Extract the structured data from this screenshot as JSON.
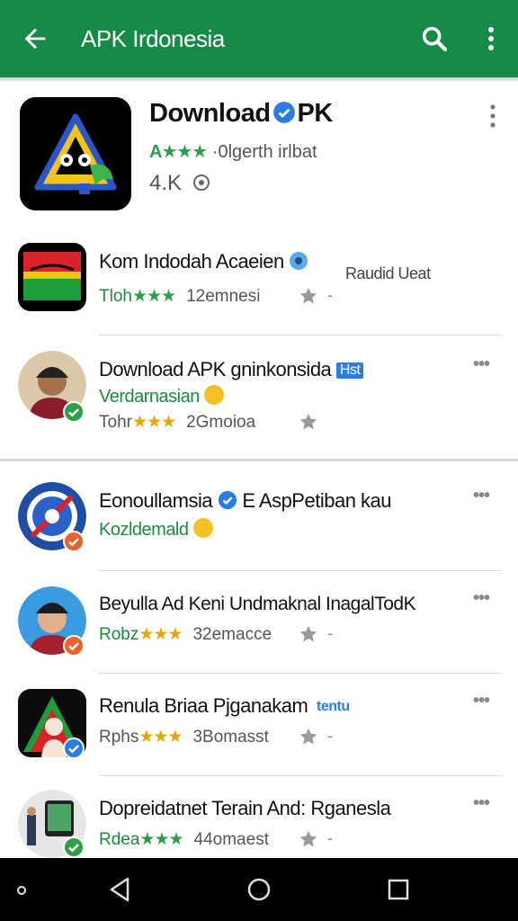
{
  "appbar": {
    "title": "APK Irdonesia",
    "back_icon": "arrow-left-icon",
    "search_icon": "search-icon",
    "menu_icon": "more-vert-icon"
  },
  "featured": {
    "title_pre": "Download",
    "title_post": "PK",
    "rating_stars": "A★★★",
    "rating_text": "·0lgerth irlbat",
    "count": "4.K",
    "count_icon": "info-icon"
  },
  "apps": [
    {
      "name": "Kom Indodah Acaeien",
      "side_text": "Raudid Ueat",
      "meta_prefix": "Tloh",
      "stars": "★★★",
      "meta_count": "12emnesi"
    },
    {
      "name": "Download APK gninkonsida",
      "tag": "Hst",
      "subtitle": "Verdarnasian",
      "meta_prefix": "Tohr",
      "stars": "★★★",
      "meta_count": "2Gmoioa"
    },
    {
      "name": "Eonoullamsia",
      "name_post": "E AspPetiban kau",
      "subtitle": "Kozldemald",
      "meta_prefix": "",
      "stars": "",
      "meta_count": ""
    },
    {
      "name": "Beyulla Ad Keni Undmaknal InagalTodK",
      "meta_prefix": "Robz",
      "stars": "★★★",
      "meta_count": "32emacce"
    },
    {
      "name": "Renula Briaa Pjganakam",
      "tag": "tentu",
      "meta_prefix": "Rphs",
      "stars": "★★★",
      "meta_count": "3Bomasst"
    },
    {
      "name": "Dopreidatnet Terain And: Rganesla",
      "meta_prefix": "Rdea",
      "stars": "★★★",
      "meta_count": "44omaest"
    }
  ],
  "misc": {
    "dash": "-",
    "dots": "•••"
  },
  "colors": {
    "appbar": "#188a47",
    "green_text": "#1a8a3c",
    "star_gold": "#e0a800",
    "verified_blue": "#2a7de1"
  }
}
